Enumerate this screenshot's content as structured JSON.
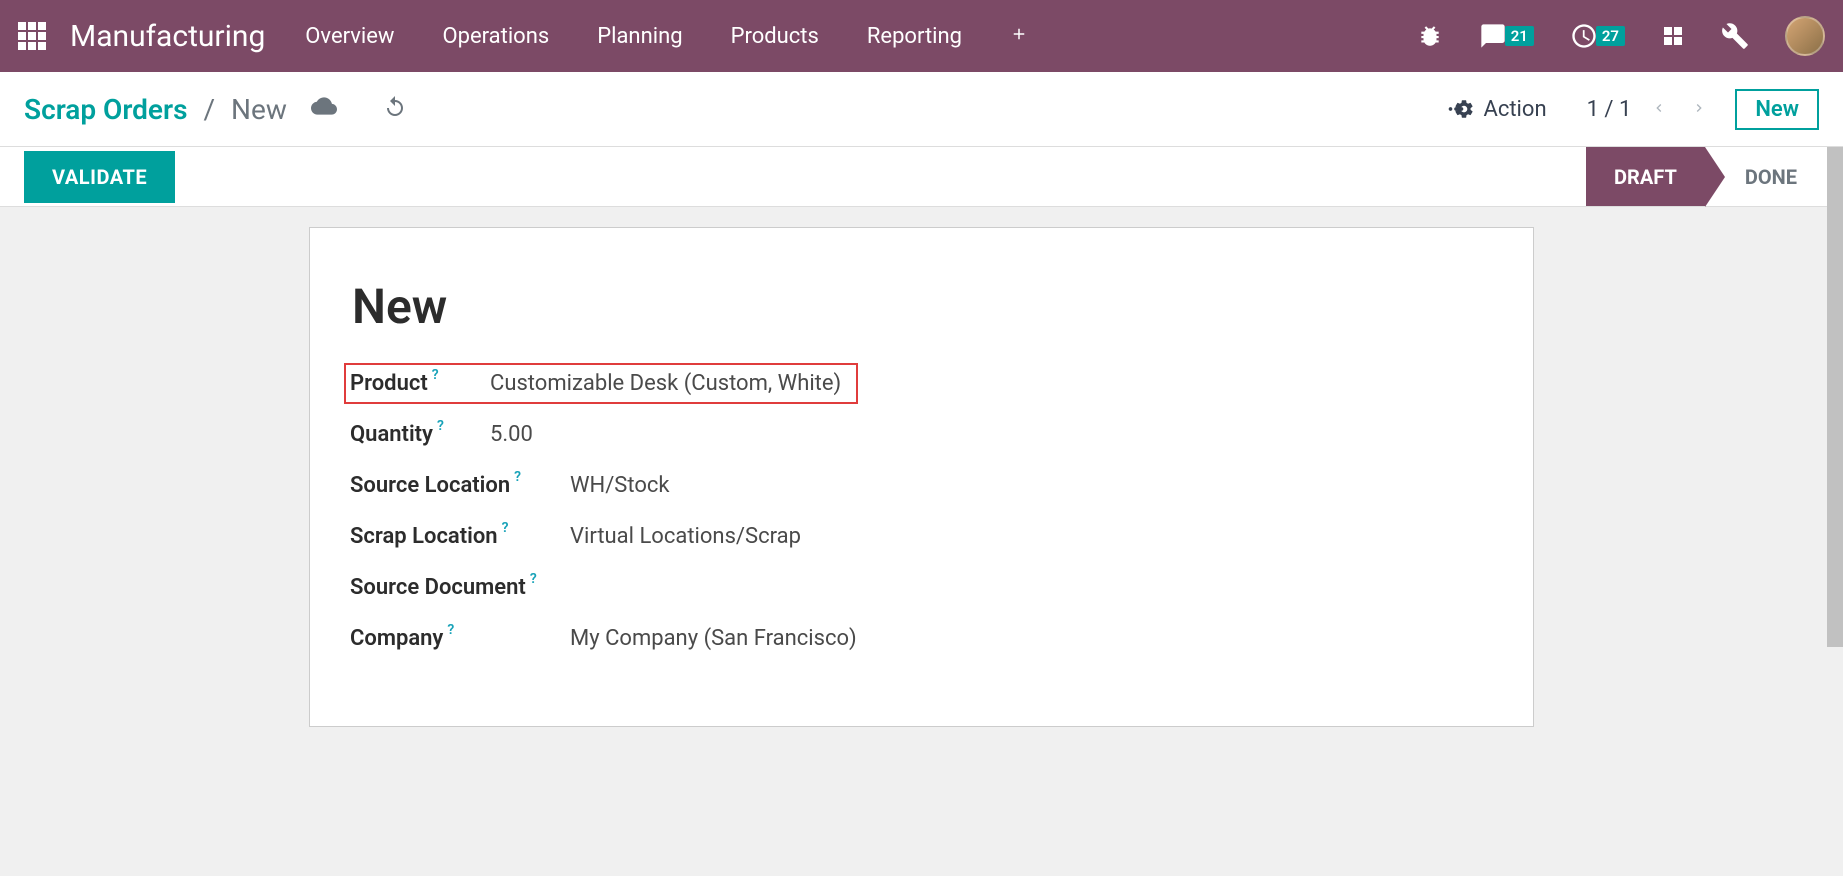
{
  "nav": {
    "app_title": "Manufacturing",
    "menu": [
      "Overview",
      "Operations",
      "Planning",
      "Products",
      "Reporting"
    ],
    "messages_badge": "21",
    "activities_badge": "27"
  },
  "control": {
    "breadcrumb_root": "Scrap Orders",
    "breadcrumb_sep": "/",
    "breadcrumb_current": "New",
    "action_label": "Action",
    "pager_text": "1 / 1",
    "new_label": "New"
  },
  "status": {
    "validate_label": "VALIDATE",
    "step_active": "DRAFT",
    "step_inactive": "DONE"
  },
  "form": {
    "title": "New",
    "fields": {
      "product": {
        "label": "Product",
        "value": "Customizable Desk (Custom, White)"
      },
      "quantity": {
        "label": "Quantity",
        "value": "5.00"
      },
      "source_location": {
        "label": "Source Location",
        "value": "WH/Stock"
      },
      "scrap_location": {
        "label": "Scrap Location",
        "value": "Virtual Locations/Scrap"
      },
      "source_document": {
        "label": "Source Document",
        "value": ""
      },
      "company": {
        "label": "Company",
        "value": "My Company (San Francisco)"
      }
    }
  }
}
